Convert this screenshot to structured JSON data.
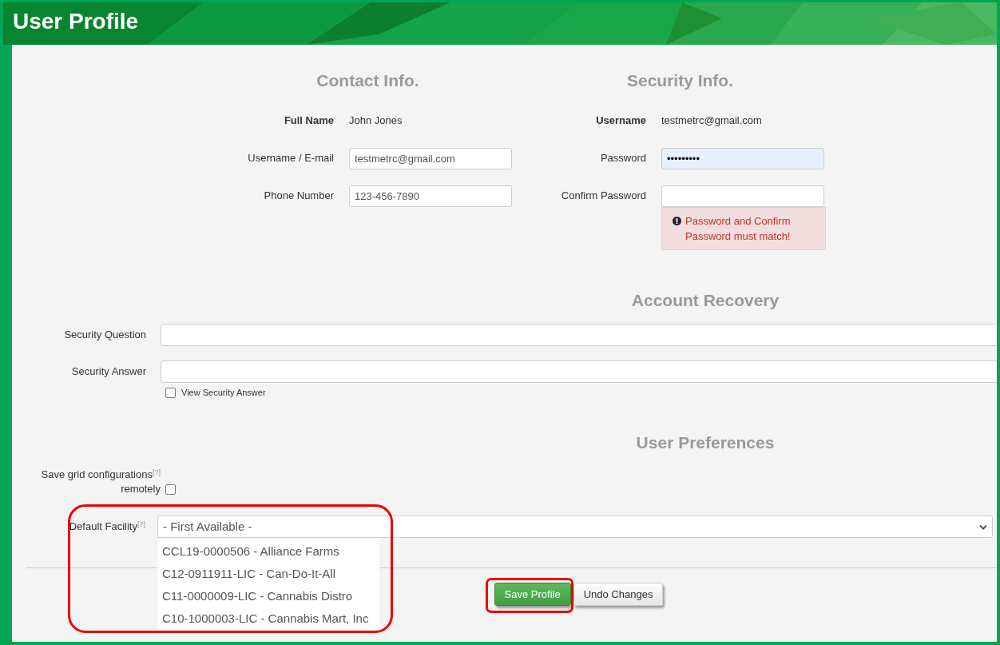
{
  "header": {
    "title": "User Profile"
  },
  "contact": {
    "heading": "Contact Info.",
    "fields": [
      {
        "kind": "static",
        "label": "Full Name",
        "value": "John Jones"
      },
      {
        "kind": "input",
        "label": "Username / E-mail",
        "value": "testmetrc@gmail.com"
      },
      {
        "kind": "input",
        "label": "Phone Number",
        "value": "123-456-7890"
      }
    ]
  },
  "security": {
    "heading": "Security Info.",
    "fields": [
      {
        "kind": "static",
        "label": "Username",
        "value": "testmetrc@gmail.com"
      },
      {
        "kind": "input",
        "label": "Password",
        "value": "•••••••••",
        "autofilled": true
      },
      {
        "kind": "input",
        "label": "Confirm Password",
        "autofilled": false,
        "error": "Password and Confirm Password must match!"
      }
    ]
  },
  "recovery": {
    "heading": "Account Recovery",
    "fields": [
      {
        "label": "Security Question"
      },
      {
        "label": "Security Answer"
      }
    ],
    "checkbox": {
      "label": "View Security Answer",
      "checked": false
    }
  },
  "preferences": {
    "heading": "User Preferences",
    "save_grid": {
      "label": "Save grid configurations$^{[?]}$ remotely",
      "checked": false
    },
    "default_facility": {
      "label": "Default Facility$^{[?]}$",
      "value": "- First Available -",
      "expanded": true,
      "highlighted": true,
      "options": [
        "CCL19-0000506 - Alliance Farms",
        "C12-0911911-LIC - Can-Do-It-All",
        "C11-0000009-LIC - Cannabis Distro",
        "C10-1000003-LIC - Cannabis Mart, Inc"
      ]
    }
  },
  "buttons": [
    {
      "kind": "primary",
      "label": "Save Profile",
      "highlighted": true
    },
    {
      "kind": "default",
      "label": "Undo Changes",
      "highlighted": false
    }
  ]
}
